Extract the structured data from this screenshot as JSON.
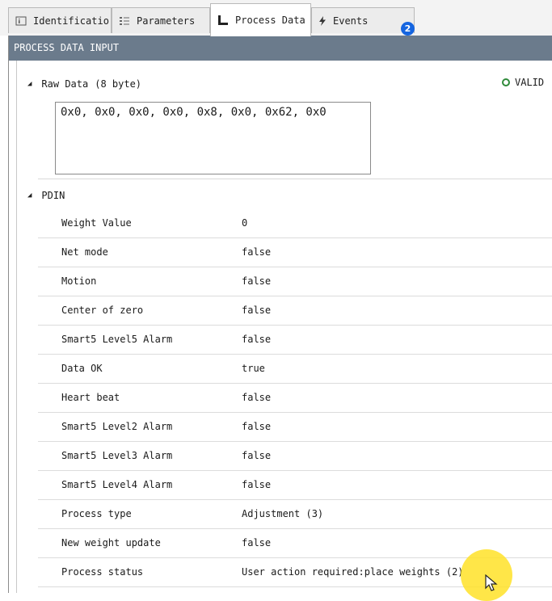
{
  "tabs": [
    {
      "label": "Identificatio",
      "icon": "info-id-icon"
    },
    {
      "label": "Parameters",
      "icon": "list-icon"
    },
    {
      "label": "Process Data",
      "icon": "process-data-icon"
    },
    {
      "label": "Events",
      "icon": "lightning-icon"
    }
  ],
  "events_badge": "2",
  "panel": {
    "header": "PROCESS DATA INPUT"
  },
  "raw_data": {
    "label": "Raw Data",
    "size": "(8 byte)",
    "status": "VALID",
    "value": "0x0, 0x0, 0x0, 0x0, 0x8, 0x0, 0x62, 0x0"
  },
  "pdin": {
    "label": "PDIN",
    "rows": [
      {
        "key": "Weight Value",
        "value": "0"
      },
      {
        "key": "Net mode",
        "value": "false"
      },
      {
        "key": "Motion",
        "value": "false"
      },
      {
        "key": "Center of zero",
        "value": "false"
      },
      {
        "key": "Smart5 Level5 Alarm",
        "value": "false"
      },
      {
        "key": "Data OK",
        "value": "true"
      },
      {
        "key": "Heart beat",
        "value": "false"
      },
      {
        "key": "Smart5 Level2 Alarm",
        "value": "false"
      },
      {
        "key": "Smart5 Level3 Alarm",
        "value": "false"
      },
      {
        "key": "Smart5 Level4 Alarm",
        "value": "false"
      },
      {
        "key": "Process type",
        "value": "Adjustment (3)"
      },
      {
        "key": "New weight update",
        "value": "false"
      },
      {
        "key": "Process status",
        "value": "User action required:place weights (2)"
      }
    ]
  },
  "colors": {
    "header_bg": "#6b7b8c",
    "badge": "#1565e0",
    "valid": "#2f8a3a",
    "cursor_highlight": "#ffe228"
  }
}
